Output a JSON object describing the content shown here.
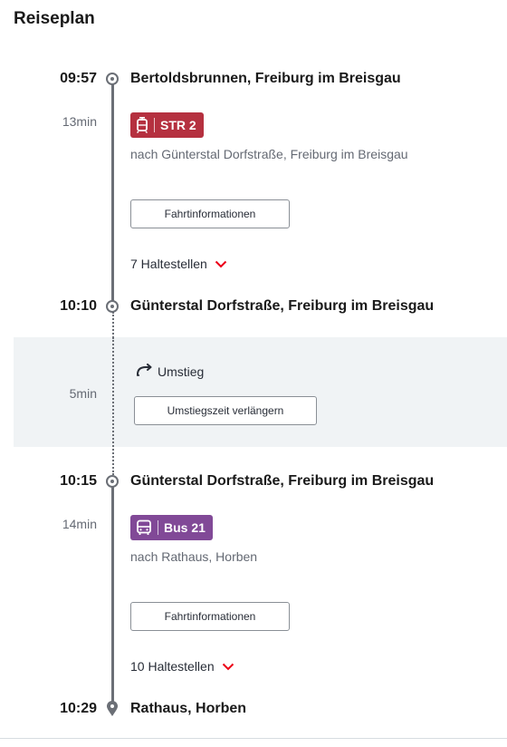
{
  "title": "Reiseplan",
  "segments": [
    {
      "dep_time": "09:57",
      "dep_stop": "Bertoldsbrunnen, Freiburg im Breisgau",
      "duration": "13min",
      "line": "STR 2",
      "line_icon": "tram-icon",
      "line_color": "#b5303f",
      "direction": "nach Günterstal Dorfstraße, Freiburg im Breisgau",
      "info_button": "Fahrtinformationen",
      "stops_toggle": "7 Haltestellen",
      "arr_time": "10:10",
      "arr_stop": "Günterstal Dorfstraße, Freiburg im Breisgau"
    },
    {
      "dep_time": "10:15",
      "dep_stop": "Günterstal Dorfstraße, Freiburg im Breisgau",
      "duration": "14min",
      "line": "Bus 21",
      "line_icon": "bus-icon",
      "line_color": "#814997",
      "direction": "nach Rathaus, Horben",
      "info_button": "Fahrtinformationen",
      "stops_toggle": "10 Haltestellen",
      "arr_time": "10:29",
      "arr_stop": "Rathaus, Horben"
    }
  ],
  "transfer": {
    "duration": "5min",
    "label": "Umstieg",
    "extend_button": "Umstiegszeit verlängern"
  },
  "colors": {
    "accent_red": "#ec0016",
    "line_gray": "#6b6f76",
    "transfer_bg": "#f0f3f5"
  }
}
